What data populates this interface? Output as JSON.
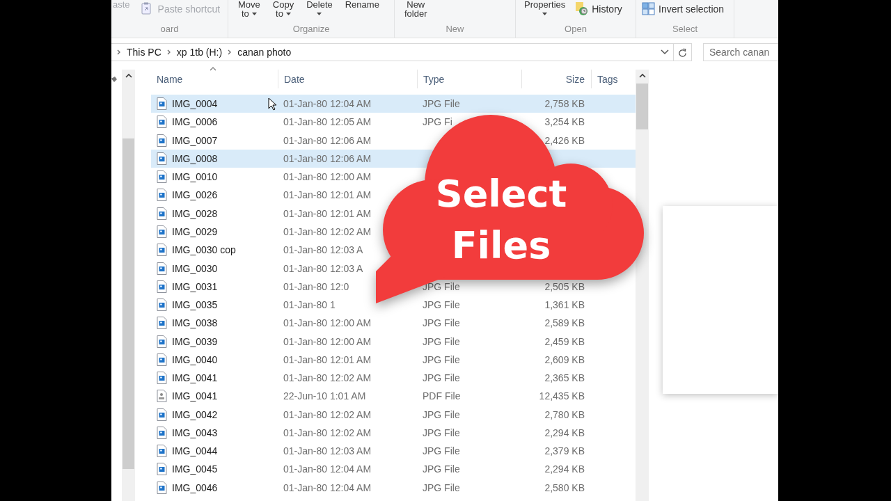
{
  "ribbon": {
    "groups": [
      {
        "label": "oard",
        "items": [
          {
            "kind": "stack",
            "lines": [
              "aste"
            ],
            "caret": false,
            "disabled": true
          },
          {
            "kind": "shortcut",
            "label": "Paste shortcut",
            "disabled": true
          }
        ]
      },
      {
        "label": "Organize",
        "items": [
          {
            "kind": "stack",
            "lines": [
              "Move",
              "to"
            ],
            "caret": true,
            "disabled": false
          },
          {
            "kind": "stack",
            "lines": [
              "Copy",
              "to"
            ],
            "caret": true,
            "disabled": false
          },
          {
            "kind": "stack",
            "lines": [
              "Delete"
            ],
            "caret": true,
            "disabled": false
          },
          {
            "kind": "stack",
            "lines": [
              "Rename"
            ],
            "caret": false,
            "disabled": false
          }
        ]
      },
      {
        "label": "New",
        "items": [
          {
            "kind": "stack",
            "lines": [
              "New",
              "folder"
            ],
            "caret": false,
            "disabled": false
          }
        ]
      },
      {
        "label": "Open",
        "items": [
          {
            "kind": "stack",
            "lines": [
              "Properties"
            ],
            "caret": true,
            "disabled": false
          },
          {
            "kind": "history",
            "label": "History",
            "disabled": false
          }
        ]
      },
      {
        "label": "Select",
        "items": [
          {
            "kind": "invert",
            "label": "Invert selection",
            "disabled": false
          }
        ]
      }
    ]
  },
  "address": {
    "breadcrumbs": [
      "This PC",
      "xp 1tb (H:)",
      "canan photo"
    ]
  },
  "search": {
    "placeholder": "Search canan"
  },
  "table": {
    "columns": [
      {
        "label": "Name",
        "sorted": true
      },
      {
        "label": "Date",
        "sorted": false
      },
      {
        "label": "Type",
        "sorted": false
      },
      {
        "label": "Size",
        "sorted": false
      },
      {
        "label": "Tags",
        "sorted": false
      }
    ],
    "rows": [
      {
        "kind": "jpg",
        "name": "IMG_0004",
        "date": "01-Jan-80 12:04 AM",
        "type": "JPG File",
        "size": "2,758 KB",
        "selected": true
      },
      {
        "kind": "jpg",
        "name": "IMG_0006",
        "date": "01-Jan-80 12:05 AM",
        "type": "JPG Fi",
        "size": "3,254 KB",
        "selected": false
      },
      {
        "kind": "jpg",
        "name": "IMG_0007",
        "date": "01-Jan-80 12:06 AM",
        "size": "2,426 KB",
        "selected": false
      },
      {
        "kind": "jpg",
        "name": "IMG_0008",
        "date": "01-Jan-80 12:06 AM",
        "selected": true
      },
      {
        "kind": "jpg",
        "name": "IMG_0010",
        "date": "01-Jan-80 12:00 AM",
        "selected": false
      },
      {
        "kind": "jpg",
        "name": "IMG_0026",
        "date": "01-Jan-80 12:01 AM",
        "selected": false
      },
      {
        "kind": "jpg",
        "name": "IMG_0028",
        "date": "01-Jan-80 12:01 AM",
        "selected": false
      },
      {
        "kind": "jpg",
        "name": "IMG_0029",
        "date": "01-Jan-80 12:02 AM",
        "selected": false
      },
      {
        "kind": "jpg",
        "name": "IMG_0030 cop",
        "date": "01-Jan-80 12:03 A",
        "selected": false
      },
      {
        "kind": "jpg",
        "name": "IMG_0030",
        "date": "01-Jan-80 12:03 A",
        "selected": false
      },
      {
        "kind": "jpg",
        "name": "IMG_0031",
        "date": "01-Jan-80 12:0",
        "type": "JPG File",
        "size": "2,505 KB",
        "selected": false
      },
      {
        "kind": "jpg",
        "name": "IMG_0035",
        "date": "01-Jan-80 1",
        "type": "JPG File",
        "size": "1,361 KB",
        "selected": false
      },
      {
        "kind": "jpg",
        "name": "IMG_0038",
        "date": "01-Jan-80 12:00 AM",
        "type": "JPG File",
        "size": "2,589 KB",
        "selected": false
      },
      {
        "kind": "jpg",
        "name": "IMG_0039",
        "date": "01-Jan-80 12:00 AM",
        "type": "JPG File",
        "size": "2,459 KB",
        "selected": false
      },
      {
        "kind": "jpg",
        "name": "IMG_0040",
        "date": "01-Jan-80 12:01 AM",
        "type": "JPG File",
        "size": "2,609 KB",
        "selected": false
      },
      {
        "kind": "jpg",
        "name": "IMG_0041",
        "date": "01-Jan-80 12:02 AM",
        "type": "JPG File",
        "size": "2,365 KB",
        "selected": false
      },
      {
        "kind": "pdf",
        "name": "IMG_0041",
        "date": "22-Jun-10 1:01 AM",
        "type": "PDF File",
        "size": "12,435 KB",
        "selected": false
      },
      {
        "kind": "jpg",
        "name": "IMG_0042",
        "date": "01-Jan-80 12:02 AM",
        "type": "JPG File",
        "size": "2,780 KB",
        "selected": false
      },
      {
        "kind": "jpg",
        "name": "IMG_0043",
        "date": "01-Jan-80 12:02 AM",
        "type": "JPG File",
        "size": "2,294 KB",
        "selected": false
      },
      {
        "kind": "jpg",
        "name": "IMG_0044",
        "date": "01-Jan-80 12:03 AM",
        "type": "JPG File",
        "size": "2,379 KB",
        "selected": false
      },
      {
        "kind": "jpg",
        "name": "IMG_0045",
        "date": "01-Jan-80 12:04 AM",
        "type": "JPG File",
        "size": "2,294 KB",
        "selected": false
      },
      {
        "kind": "jpg",
        "name": "IMG_0046",
        "date": "01-Jan-80 12:04 AM",
        "type": "JPG File",
        "size": "2,580 KB",
        "selected": false
      }
    ]
  },
  "callout": {
    "lines": [
      "Select",
      "Files"
    ]
  }
}
